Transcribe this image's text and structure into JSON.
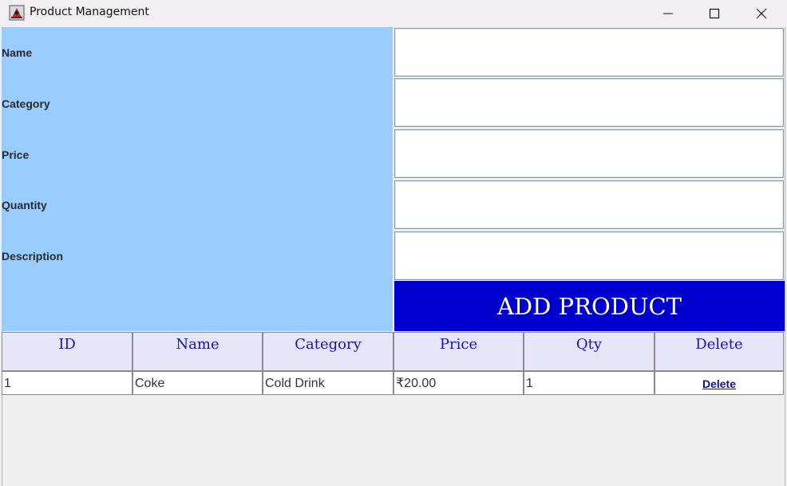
{
  "window": {
    "title": "Product Management",
    "app_icon": "java-duke-icon",
    "controls": [
      "minimize-icon",
      "maximize-icon",
      "close-icon"
    ]
  },
  "form": {
    "labels": {
      "name": "Name",
      "category": "Category",
      "price": "Price",
      "quantity": "Quantity",
      "description": "Description"
    },
    "values": {
      "name": "",
      "category": "",
      "price": "",
      "quantity": "",
      "description": ""
    },
    "add_button_label": "ADD PRODUCT"
  },
  "table": {
    "headers": [
      "ID",
      "Name",
      "Category",
      "Price",
      "Qty",
      "Delete"
    ],
    "rows": [
      {
        "id": "1",
        "name": "Coke",
        "category": "Cold Drink",
        "price": "₹20.00",
        "qty": "1",
        "delete_label": "Delete"
      }
    ]
  },
  "colors": {
    "form_panel": "#99ccff",
    "add_button": "#0000cc",
    "header_bg": "#e6e6fa",
    "header_text": "#1515b0"
  }
}
